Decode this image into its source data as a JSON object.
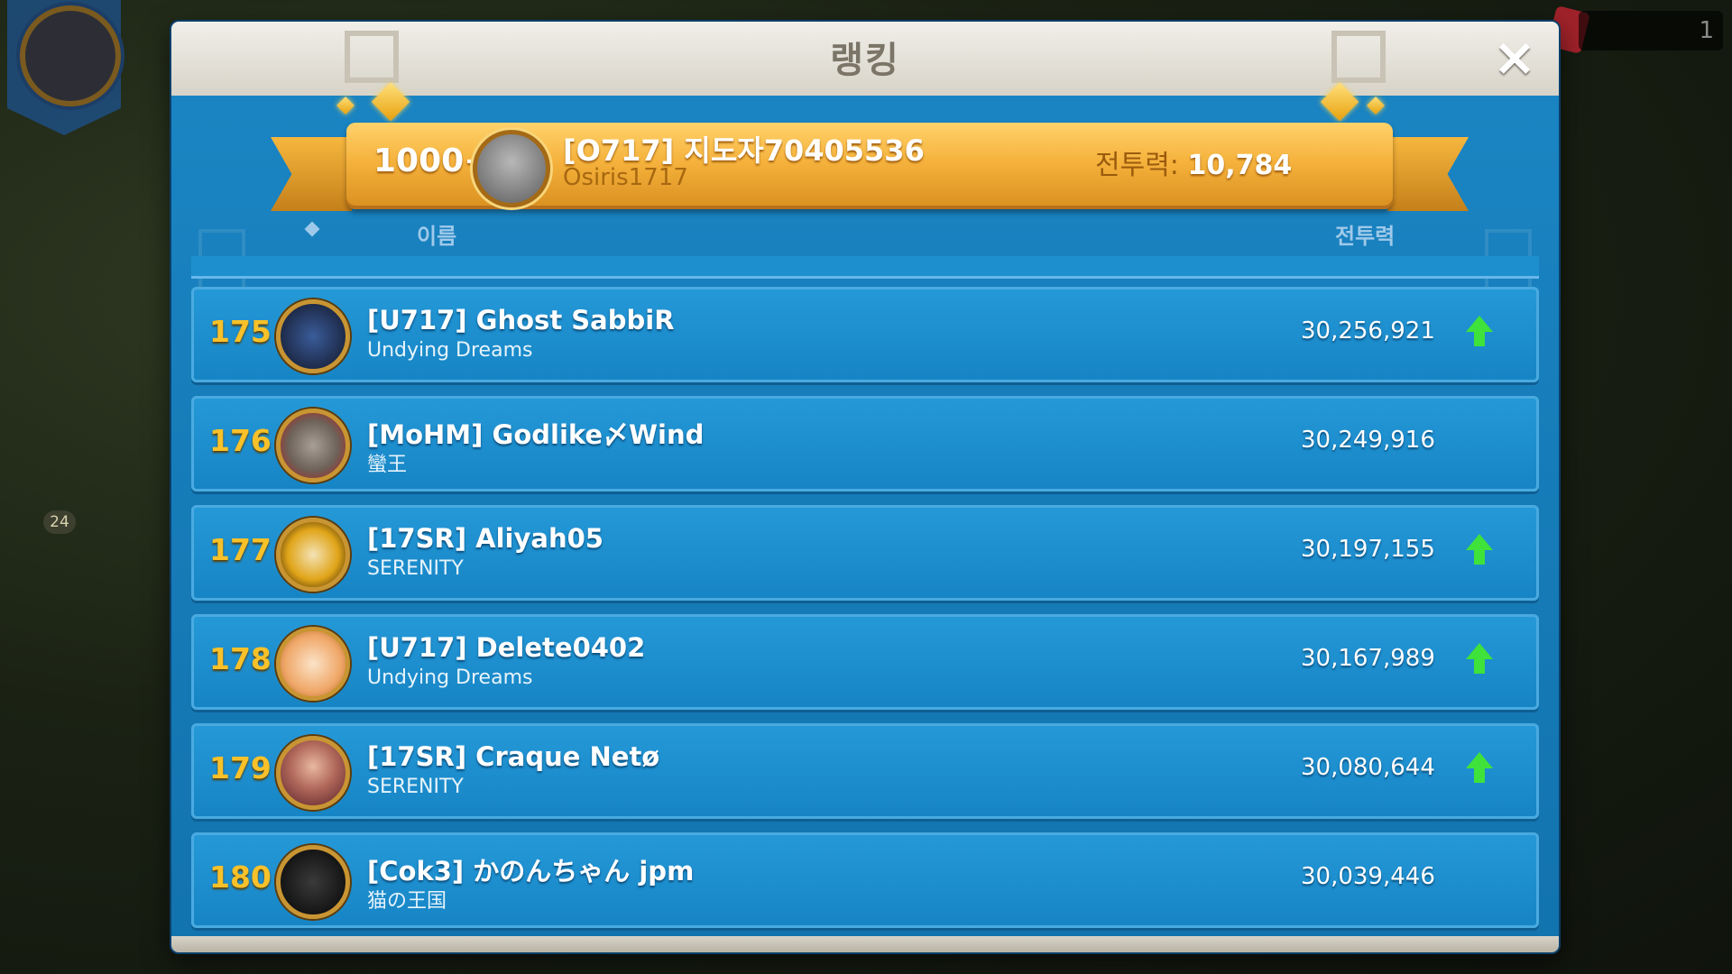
{
  "background": {
    "resource_count": "1",
    "badge": "24"
  },
  "dialog": {
    "title": "랭킹",
    "close_icon": "close-icon"
  },
  "my_rank": {
    "rank": "1000+",
    "name": "[O717] 지도자70405536",
    "alliance": "Osiris1717",
    "power_label": "전투력:",
    "power_value": "10,784"
  },
  "columns": {
    "name": "이름",
    "power": "전투력"
  },
  "rows": [
    {
      "rank": "175",
      "name": "[U717] Ghost SabbiR",
      "alliance": "Undying Dreams",
      "power": "30,256,921",
      "trend_up": true,
      "avatar_color": "#1e2b4a"
    },
    {
      "rank": "176",
      "name": "[MoHM] Godlike〆Wind",
      "alliance": "蠻王",
      "power": "30,249,916",
      "trend_up": false,
      "avatar_color": "#6d6158"
    },
    {
      "rank": "177",
      "name": "[17SR] Aliyah05",
      "alliance": "SERENITY",
      "power": "30,197,155",
      "trend_up": true,
      "avatar_color": "#e0a418"
    },
    {
      "rank": "178",
      "name": "[U717] Delete0402",
      "alliance": "Undying Dreams",
      "power": "30,167,989",
      "trend_up": true,
      "avatar_color": "#f0a869"
    },
    {
      "rank": "179",
      "name": "[17SR] Craque Netø",
      "alliance": "SERENITY",
      "power": "30,080,644",
      "trend_up": true,
      "avatar_color": "#7a3e3e"
    },
    {
      "rank": "180",
      "name": "[Cok3] かのんちゃん jpm",
      "alliance": "猫の王国",
      "power": "30,039,446",
      "trend_up": false,
      "avatar_color": "#151515"
    }
  ]
}
